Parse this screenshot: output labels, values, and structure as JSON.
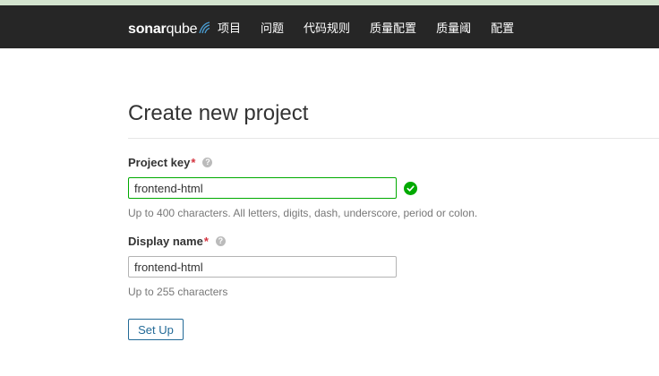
{
  "header": {
    "logo_bold": "sonar",
    "logo_light": "qube",
    "nav_items": [
      "项目",
      "问题",
      "代码规则",
      "质量配置",
      "质量阈",
      "配置"
    ]
  },
  "page": {
    "title": "Create new project"
  },
  "form": {
    "project_key": {
      "label": "Project key",
      "required_mark": "*",
      "value": "frontend-html",
      "hint": "Up to 400 characters. All letters, digits, dash, underscore, period or colon.",
      "valid": true
    },
    "display_name": {
      "label": "Display name",
      "required_mark": "*",
      "value": "frontend-html",
      "hint": "Up to 255 characters"
    },
    "help_glyph": "?",
    "submit_label": "Set Up"
  },
  "colors": {
    "navbar": "#262626",
    "valid_green": "#00aa00",
    "required_red": "#d4333f",
    "button_blue": "#236a97"
  }
}
